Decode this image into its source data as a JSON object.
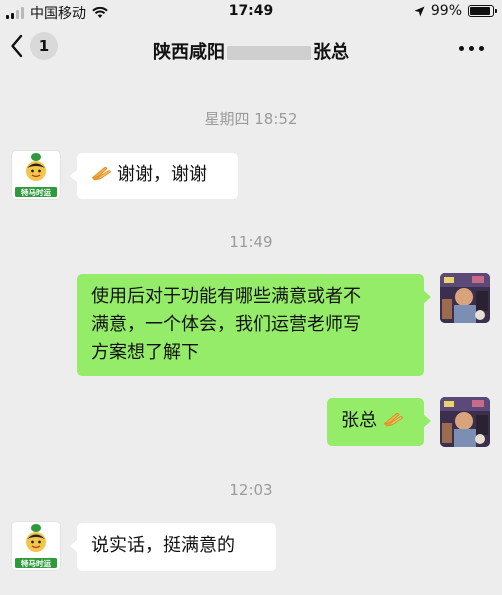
{
  "status_bar": {
    "carrier": "中国移动",
    "time": "17:49",
    "battery": "99%",
    "battery_level": 0.99
  },
  "header": {
    "unread_count": "1",
    "title_prefix": "陕西咸阳",
    "title_suffix": "张总"
  },
  "messages": [
    {
      "type": "timestamp",
      "text": "星期四 18:52"
    },
    {
      "type": "received",
      "text": "谢谢，谢谢",
      "emoji": "folded-hands-icon",
      "avatar_label": "特马时运"
    },
    {
      "type": "timestamp",
      "text": "11:49"
    },
    {
      "type": "sent",
      "lines": [
        "使用后对于功能有哪些满意或者不",
        "满意，一个体会，我们运营老师写",
        "方案想了解下"
      ]
    },
    {
      "type": "sent",
      "text": "张总",
      "emoji": "folded-hands-icon"
    },
    {
      "type": "timestamp",
      "text": "12:03"
    },
    {
      "type": "received",
      "text": "说实话，挺满意的",
      "avatar_label": "特马时运"
    }
  ],
  "colors": {
    "background": "#ededed",
    "sent_bubble": "#95ec69",
    "received_bubble": "#ffffff",
    "logo_green": "#2f9a3c",
    "timestamp": "#9b9b9b"
  }
}
